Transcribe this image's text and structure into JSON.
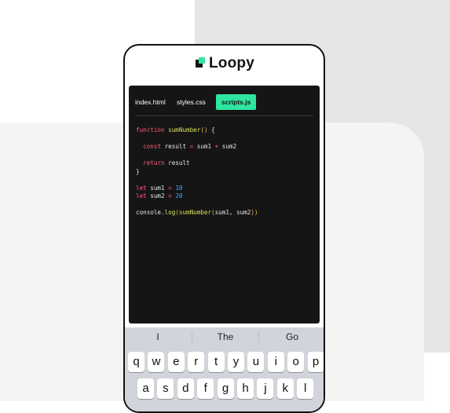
{
  "app": {
    "logo_text": "Loopy"
  },
  "editor": {
    "tabs": [
      {
        "label": "index.html",
        "active": false
      },
      {
        "label": "styles.css",
        "active": false
      },
      {
        "label": "scripts.js",
        "active": true
      }
    ],
    "code_lines": [
      "function sumNumber() {",
      "",
      "  const result = sum1 + sum2",
      "",
      "  return result",
      "}",
      "",
      "let sum1 = 10",
      "let sum2 = 20",
      "",
      "console.log(sumNumber(sum1, sum2))"
    ]
  },
  "keyboard": {
    "suggestions": [
      "I",
      "The",
      "Go"
    ],
    "row1": [
      "q",
      "w",
      "e",
      "r",
      "t",
      "y",
      "u",
      "i",
      "o",
      "p"
    ],
    "row2": [
      "a",
      "s",
      "d",
      "f",
      "g",
      "h",
      "j",
      "k",
      "l"
    ]
  },
  "colors": {
    "accent": "#2ee6a0",
    "editor_bg": "#151515",
    "keyword": "#ff5a7a",
    "function": "#d6e05a",
    "number": "#4aa3ff"
  },
  "icons": {
    "logo": "loopy-logo-icon"
  }
}
